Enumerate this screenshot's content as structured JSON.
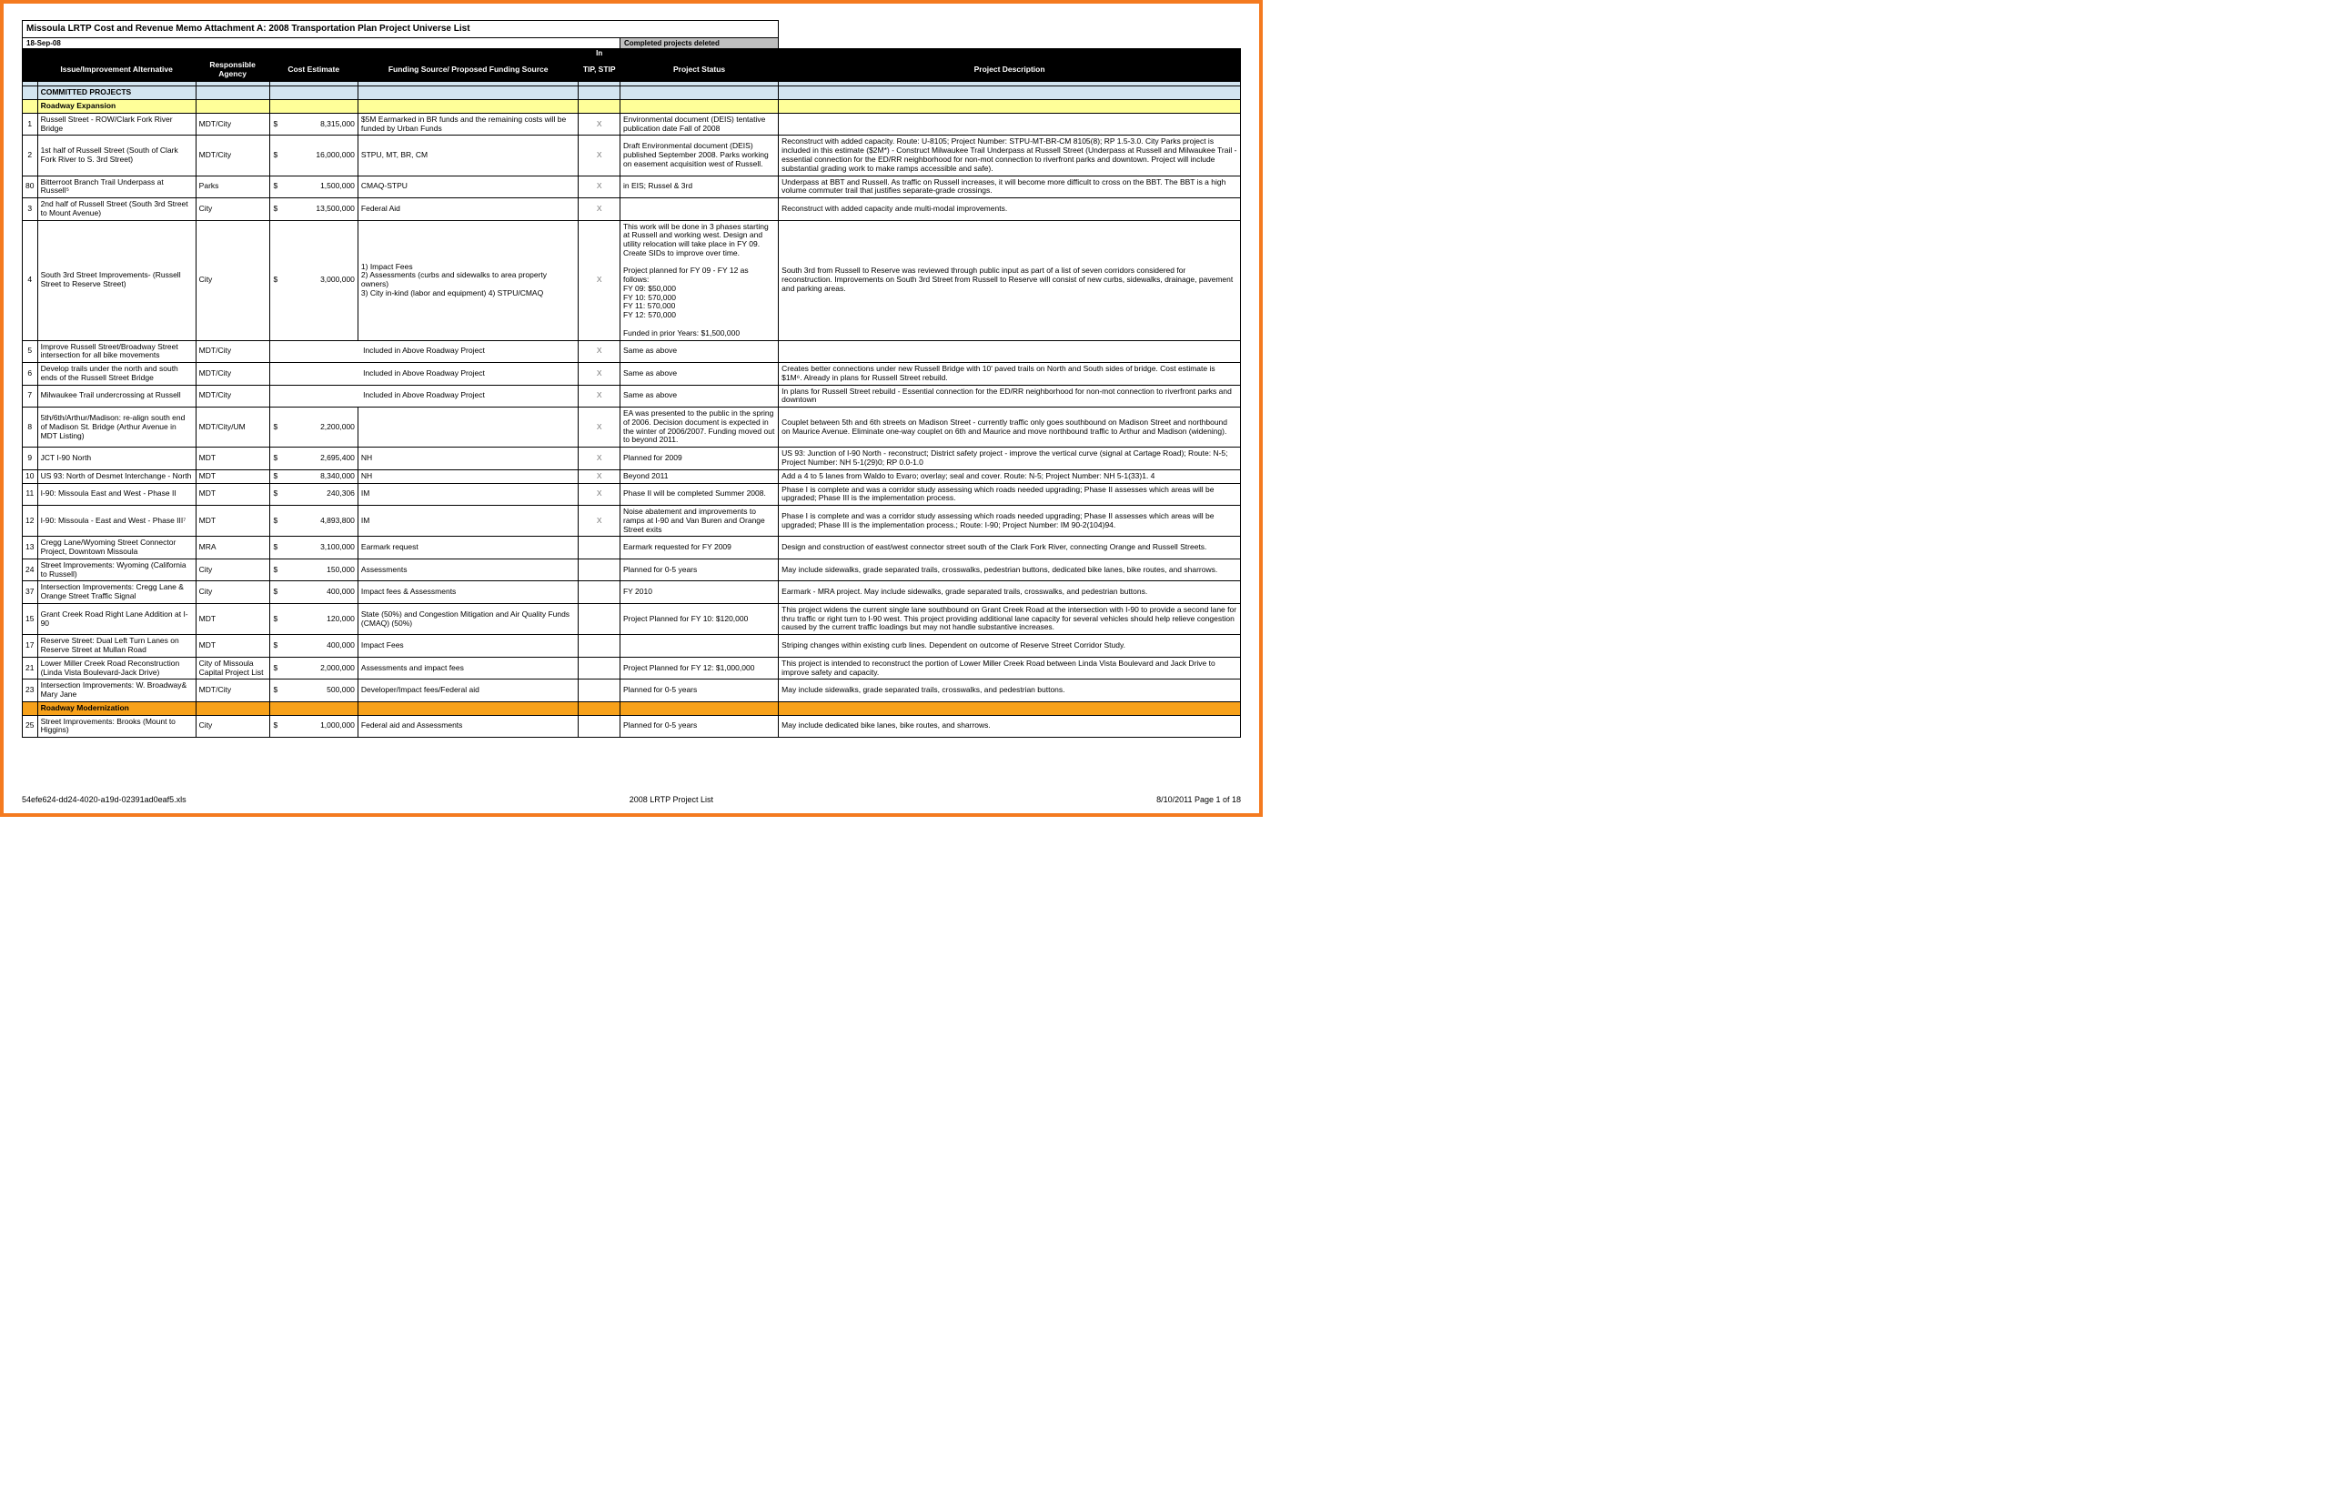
{
  "title": "Missoula LRTP Cost and Revenue Memo Attachment A:  2008 Transportation Plan Project Universe List",
  "date": "18-Sep-08",
  "completed_note": "Completed projects deleted",
  "headers": {
    "in": "In",
    "issue": "Issue/Improvement Alternative",
    "agency": "Responsible Agency",
    "cost": "Cost Estimate",
    "funding": "Funding Source/ Proposed Funding Source",
    "tip": "TIP, STIP",
    "status": "Project Status",
    "desc": "Project Description"
  },
  "section_committed": "COMMITTED PROJECTS",
  "section_expansion": "Roadway Expansion",
  "section_modernization": "Roadway Modernization",
  "rows": [
    {
      "n": "1",
      "issue": "Russell Street - ROW/Clark Fork River Bridge",
      "agency": "MDT/City",
      "cost": "8,315,000",
      "funding": "$5M Earmarked in BR funds and the remaining costs will be funded by Urban Funds",
      "tip": "X",
      "status": "Environmental document (DEIS) tentative publication date Fall of 2008",
      "desc": ""
    },
    {
      "n": "2",
      "issue": "1st half of Russell Street (South of Clark Fork River to S. 3rd Street)",
      "agency": "MDT/City",
      "cost": "16,000,000",
      "funding": "STPU, MT, BR, CM",
      "tip": "X",
      "status": "Draft Environmental document (DEIS) published September 2008. Parks working on easement acquisition west of Russell.",
      "desc": "Reconstruct with added capacity. Route: U-8105; Project Number: STPU-MT-BR-CM 8105(8); RP 1.5-3.0. City Parks project is included in this estimate ($2M*) - Construct Milwaukee Trail Underpass at Russell Street  (Underpass at Russell and Milwaukee Trail - essential connection for the ED/RR neighborhood for non-mot connection to riverfront parks and downtown. Project will include substantial grading work to make ramps accessible and safe)."
    },
    {
      "n": "80",
      "issue": "Bitterroot Branch Trail Underpass at Russell⁵",
      "agency": "Parks",
      "cost": "1,500,000",
      "funding": "CMAQ-STPU",
      "tip": "X",
      "status": "in EIS; Russel & 3rd",
      "desc": "Underpass at BBT and Russell. As traffic on Russell increases, it will become more difficult to cross on the BBT.  The BBT is a high volume commuter trail that justifies separate-grade crossings."
    },
    {
      "n": "3",
      "issue": "2nd half of Russell Street (South 3rd Street to Mount Avenue)",
      "agency": "City",
      "cost": "13,500,000",
      "funding": "Federal Aid",
      "tip": "X",
      "status": "",
      "desc": "Reconstruct with added capacity ande multi-modal improvements."
    },
    {
      "n": "4",
      "issue": "South 3rd Street Improvements- (Russell Street to Reserve Street)",
      "agency": "City",
      "cost": "3,000,000",
      "funding": "1) Impact Fees\n2) Assessments (curbs and sidewalks to area property owners)\n3) City in-kind (labor and equipment) 4) STPU/CMAQ",
      "tip": "X",
      "status": "This work will be done in 3 phases starting at Russell and working west. Design and utility relocation will take place in FY 09. Create SIDs to improve over time.\n\nProject planned for FY 09 - FY 12 as follows:\n     FY 09: $50,000\n     FY 10: 570,000\n     FY 11: 570,000\n     FY 12: 570,000\n\nFunded in prior Years: $1,500,000",
      "desc": "South 3rd from Russell to Reserve was reviewed through public input as part of a list of seven corridors considered for reconstruction.   Improvements on South 3rd Street from Russell to Reserve will consist of new curbs, sidewalks, drainage, pavement and parking areas."
    },
    {
      "n": "5",
      "issue": "Improve Russell Street/Broadway Street intersection for all bike movements",
      "agency": "MDT/City",
      "cost": "",
      "funding": "Included in Above Roadway Project",
      "tip": "X",
      "status": "Same as above",
      "desc": ""
    },
    {
      "n": "6",
      "issue": "Develop trails under the north and south ends of the Russell Street Bridge",
      "agency": "MDT/City",
      "cost": "",
      "funding": "Included in Above Roadway Project",
      "tip": "X",
      "status": "Same as above",
      "desc": "Creates better connections under new Russell Bridge with 10' paved trails on North and South sides of bridge. Cost estimate is $1M⁶. Already in plans for Russell Street rebuild."
    },
    {
      "n": "7",
      "issue": "Milwaukee Trail undercrossing at Russell",
      "agency": "MDT/City",
      "cost": "",
      "funding": "Included in Above Roadway Project",
      "tip": "X",
      "status": "Same as above",
      "desc": "In plans for Russell Street rebuild - Essential connection for the ED/RR neighborhood for non-mot connection to riverfront parks and downtown"
    },
    {
      "n": "8",
      "issue": "5th/6th/Arthur/Madison: re-align south end of Madison St. Bridge (Arthur Avenue in MDT Listing)",
      "agency": "MDT/City/UM",
      "cost": "2,200,000",
      "funding": "",
      "tip": "X",
      "status": "EA was presented to the public in the spring of 2006. Decision document is expected in the winter of 2006/2007. Funding moved out to beyond 2011.",
      "desc": "Couplet between 5th and 6th streets on Madison Street - currently traffic only goes southbound on Madison Street and northbound on Maurice Avenue. Eliminate one-way couplet on 6th and Maurice and move northbound traffic to Arthur and Madison (widening)."
    },
    {
      "n": "9",
      "issue": "JCT I-90 North",
      "agency": "MDT",
      "cost": "2,695,400",
      "funding": "NH",
      "tip": "X",
      "status": "Planned for 2009",
      "desc": "US 93:  Junction of I-90 North - reconstruct; District safety project - improve the vertical curve (signal at Cartage Road); Route: N-5; Project Number: NH 5-1(29)0; RP 0.0-1.0"
    },
    {
      "n": "10",
      "issue": "US 93: North of Desmet Interchange - North",
      "agency": "MDT",
      "cost": "8,340,000",
      "funding": "NH",
      "tip": "X",
      "status": "Beyond 2011",
      "desc": "Add a 4 to 5 lanes from Waldo to Evaro; overlay; seal and cover. Route: N-5; Project Number: NH 5-1(33)1. 4"
    },
    {
      "n": "11",
      "issue": "I-90:  Missoula East and West - Phase II",
      "agency": "MDT",
      "cost": "240,306",
      "funding": "IM",
      "tip": "X",
      "status": "Phase II will be completed Summer 2008.",
      "desc": "Phase I is complete and was a corridor study assessing which roads needed upgrading; Phase II assesses which areas will be upgraded; Phase III is the implementation process."
    },
    {
      "n": "12",
      "issue": "I-90: Missoula - East and West - Phase III⁷",
      "agency": "MDT",
      "cost": "4,893,800",
      "funding": "IM",
      "tip": "X",
      "status": "Noise abatement and improvements to ramps at I-90 and Van Buren and Orange Street exits",
      "desc": "Phase I is complete and was a corridor study assessing which roads needed upgrading; Phase II assesses which areas will be upgraded; Phase III is the implementation process.; Route: I-90; Project Number: IM 90-2(104)94."
    },
    {
      "n": "13",
      "issue": "Cregg Lane/Wyoming Street Connector Project, Downtown Missoula",
      "agency": "MRA",
      "cost": "3,100,000",
      "funding": "Earmark request",
      "tip": "",
      "status": "Earmark requested for FY 2009",
      "desc": "Design and construction of east/west connector street south of the Clark Fork River, connecting Orange and Russell Streets."
    },
    {
      "n": "24",
      "issue": "Street Improvements: Wyoming (California to Russell)",
      "agency": "City",
      "cost": "150,000",
      "funding": "Assessments",
      "tip": "",
      "status": "Planned for 0-5 years",
      "desc": "May include sidewalks, grade separated trails, crosswalks, pedestrian buttons, dedicated bike lanes, bike routes, and sharrows."
    },
    {
      "n": "37",
      "issue": "Intersection Improvements: Cregg Lane & Orange Street Traffic Signal",
      "agency": "City",
      "cost": "400,000",
      "funding": "Impact fees & Assessments",
      "tip": "",
      "status": "FY 2010",
      "desc": "Earmark - MRA project. May include sidewalks, grade separated trails, crosswalks, and pedestrian buttons."
    },
    {
      "n": "15",
      "issue": "Grant Creek Road Right Lane Addition at I-90",
      "agency": "MDT",
      "cost": "120,000",
      "funding": "State (50%) and Congestion Mitigation and Air Quality Funds (CMAQ) (50%)",
      "tip": "",
      "status": "Project Planned for FY 10: $120,000",
      "desc": "This project widens the current single lane southbound on Grant Creek Road at the intersection with I-90 to provide a second lane for thru traffic or right turn to I-90 west. This project providing additional lane capacity for several vehicles should help relieve congestion caused by the current traffic loadings but may not handle substantive increases."
    },
    {
      "n": "17",
      "issue": "Reserve Street:  Dual Left Turn Lanes on Reserve Street at Mullan Road",
      "agency": "MDT",
      "cost": "400,000",
      "funding": "Impact Fees",
      "tip": "",
      "status": "",
      "desc": "Striping changes within existing curb lines.   Dependent on outcome of Reserve Street Corridor Study."
    },
    {
      "n": "21",
      "issue": "Lower Miller Creek Road Reconstruction (Linda Vista Boulevard-Jack Drive)",
      "agency": "City of Missoula Capital Project List",
      "cost": "2,000,000",
      "funding": "Assessments and impact fees",
      "tip": "",
      "status": "Project Planned for FY 12: $1,000,000",
      "desc": "This project is intended to reconstruct the portion of Lower Miller Creek Road between Linda Vista Boulevard and Jack Drive to improve safety and capacity."
    },
    {
      "n": "23",
      "issue": "Intersection Improvements: W. Broadway& Mary Jane",
      "agency": "MDT/City",
      "cost": "500,000",
      "funding": "Developer/Impact fees/Federal aid",
      "tip": "",
      "status": "Planned for 0-5 years",
      "desc": "May include sidewalks, grade separated trails, crosswalks, and pedestrian buttons."
    }
  ],
  "mod_rows": [
    {
      "n": "25",
      "issue": "Street Improvements: Brooks (Mount to Higgins)",
      "agency": "City",
      "cost": "1,000,000",
      "funding": "Federal aid and Assessments",
      "tip": "",
      "status": "Planned for 0-5 years",
      "desc": "May include dedicated bike lanes, bike routes, and sharrows."
    }
  ],
  "footer": {
    "left": "54efe624-dd24-4020-a19d-02391ad0eaf5.xls",
    "center": "2008 LRTP Project List",
    "right": "8/10/2011 Page 1 of 18"
  }
}
